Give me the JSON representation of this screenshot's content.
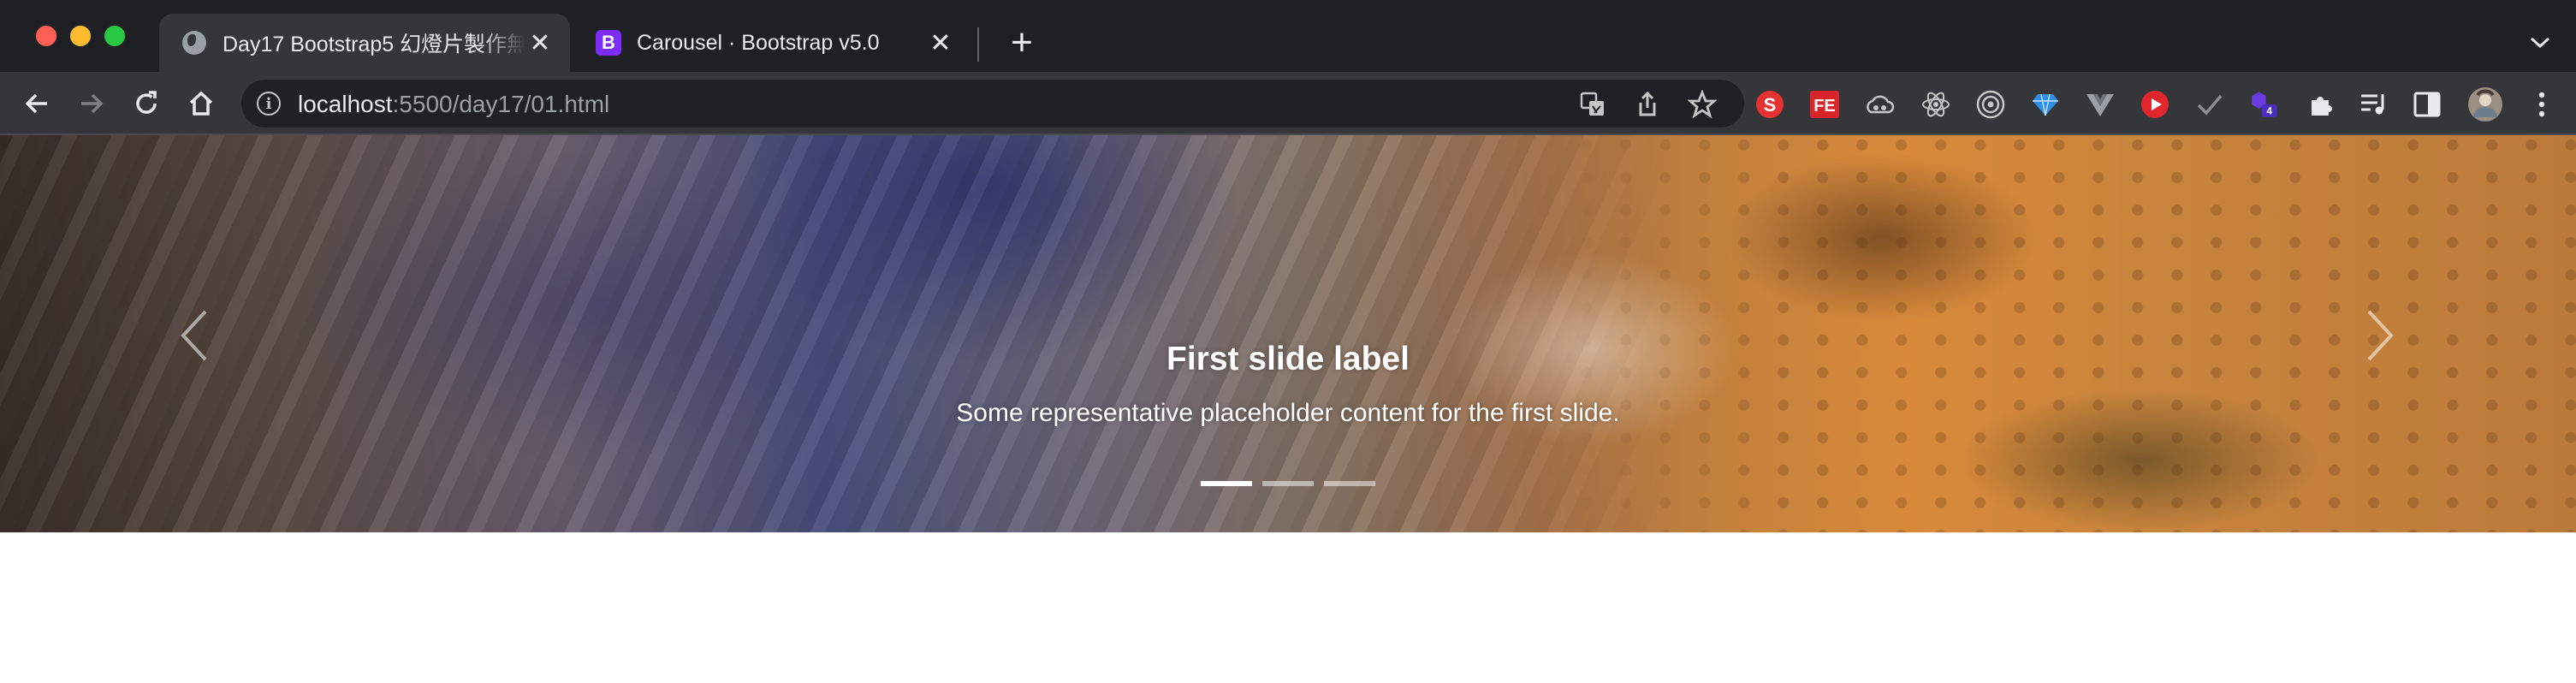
{
  "browser": {
    "tabs": [
      {
        "title": "Day17 Bootstrap5 幻燈片製作無",
        "active": true
      },
      {
        "title": "Carousel · Bootstrap v5.0",
        "active": false,
        "favicon_letter": "B"
      }
    ],
    "address": {
      "host": "localhost",
      "path": ":5500/day17/01.html"
    },
    "extensions_badge": "4",
    "extension_labels": {
      "s": "S",
      "fe": "FE"
    }
  },
  "carousel": {
    "caption_title": "First slide label",
    "caption_text": "Some representative placeholder content for the first slide.",
    "indicators": [
      {
        "active": true
      },
      {
        "active": false
      },
      {
        "active": false
      }
    ]
  },
  "colors": {
    "tabstrip": "#1f2023",
    "toolbar": "#35363a",
    "accent_bootstrap": "#7b2cf7"
  }
}
